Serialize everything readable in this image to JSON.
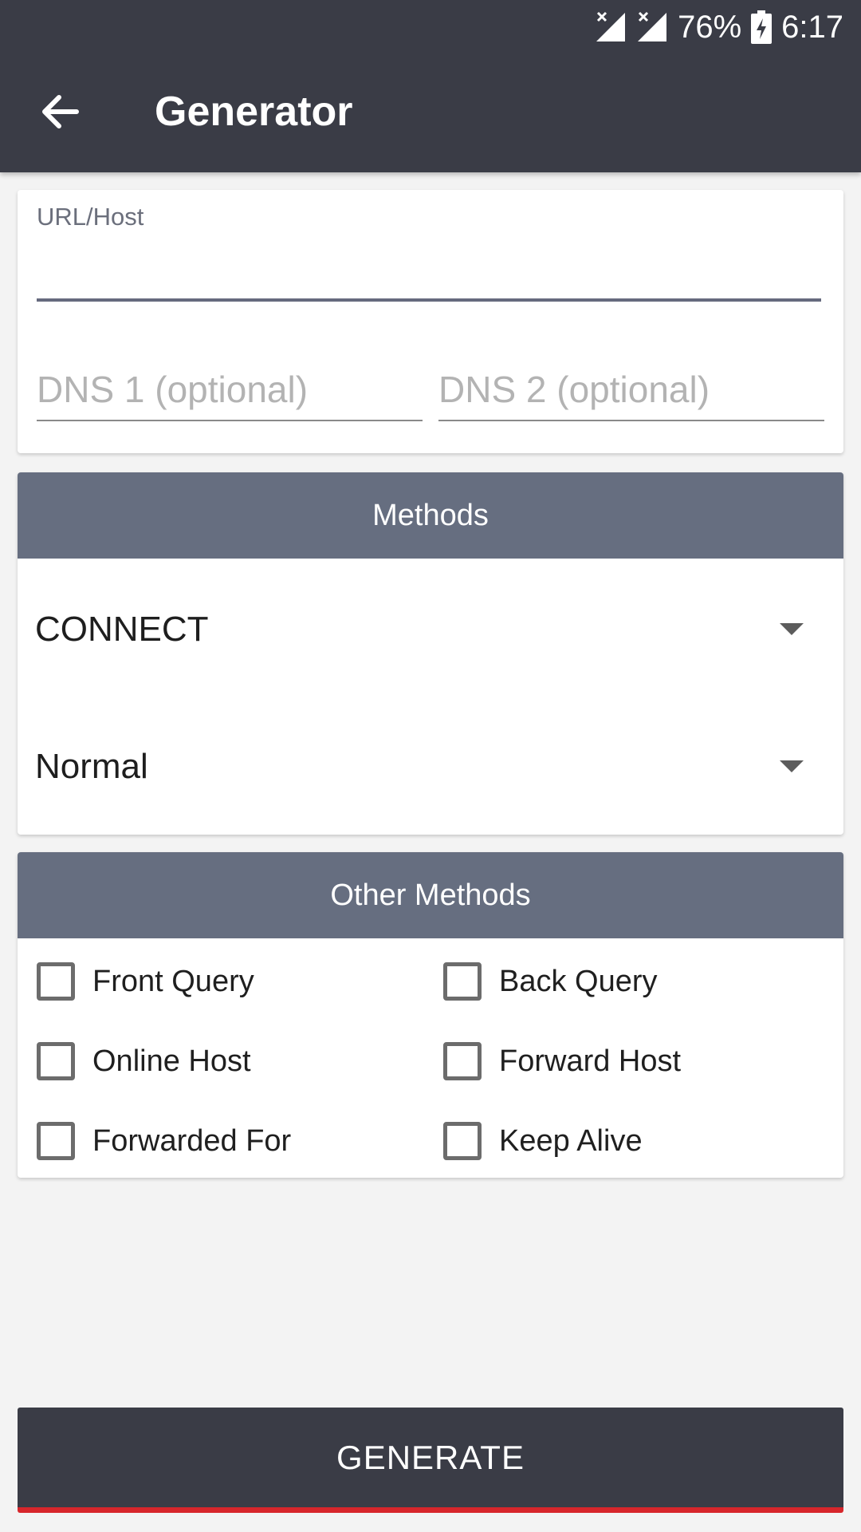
{
  "status_bar": {
    "battery": "76%",
    "time": "6:17"
  },
  "app_bar": {
    "title": "Generator"
  },
  "inputs": {
    "url_label": "URL/Host",
    "url_value": "",
    "dns1_placeholder": "DNS 1 (optional)",
    "dns2_placeholder": "DNS 2 (optional)"
  },
  "methods": {
    "header": "Methods",
    "method_selected": "CONNECT",
    "mode_selected": "Normal"
  },
  "other_methods": {
    "header": "Other Methods",
    "options": [
      {
        "label": "Front Query",
        "checked": false
      },
      {
        "label": "Back Query",
        "checked": false
      },
      {
        "label": "Online Host",
        "checked": false
      },
      {
        "label": "Forward Host",
        "checked": false
      },
      {
        "label": "Forwarded For",
        "checked": false
      },
      {
        "label": "Keep Alive",
        "checked": false
      }
    ]
  },
  "generate_label": "GENERATE",
  "colors": {
    "app_bar": "#3a3c46",
    "section_header": "#666e80",
    "accent_underline": "#d7262b"
  }
}
